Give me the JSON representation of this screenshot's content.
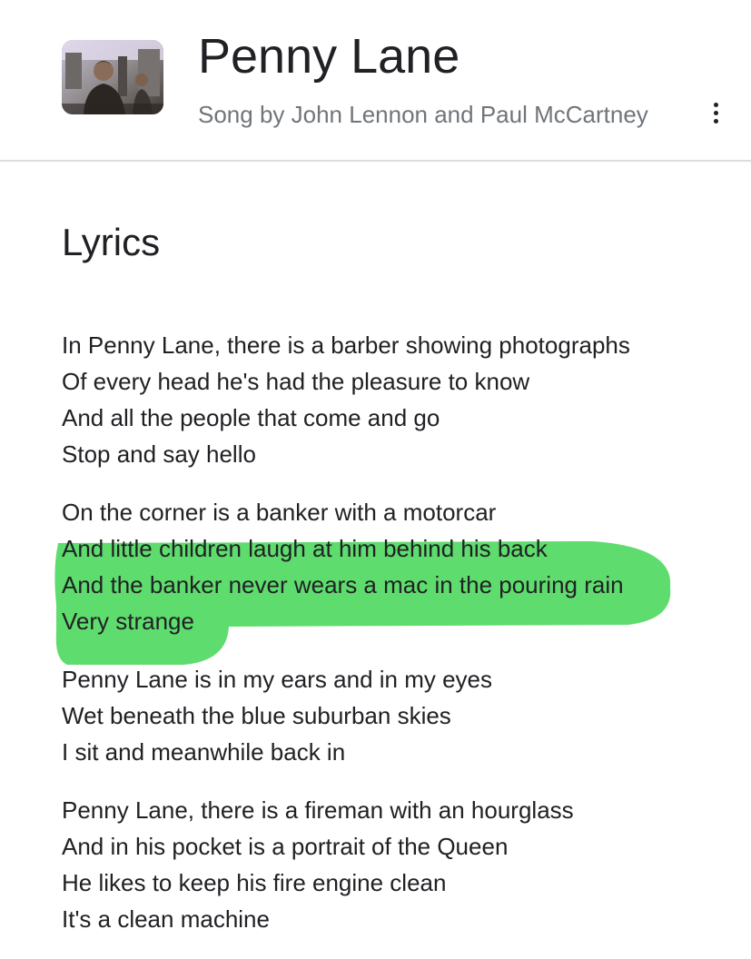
{
  "header": {
    "title": "Penny Lane",
    "subtitle": "Song by John Lennon and Paul McCartney",
    "more_icon": "more-vert-icon"
  },
  "lyrics": {
    "heading": "Lyrics",
    "stanzas": [
      {
        "lines": [
          "In Penny Lane, there is a barber showing photographs",
          "Of every head he's had the pleasure to know",
          "And all the people that come and go",
          "Stop and say hello"
        ]
      },
      {
        "lines": [
          "On the corner is a banker with a motorcar",
          "And little children laugh at him behind his back",
          "And the banker never wears a mac in the pouring rain",
          "Very strange"
        ]
      },
      {
        "lines": [
          "Penny Lane is in my ears and in my eyes",
          "Wet beneath the blue suburban skies",
          "I sit and meanwhile back in"
        ]
      },
      {
        "lines": [
          "Penny Lane, there is a fireman with an hourglass",
          "And in his pocket is a portrait of the Queen",
          "He likes to keep his fire engine clean",
          "It's a clean machine"
        ]
      }
    ]
  },
  "colors": {
    "highlight": "#5fdc6e",
    "title_text": "#202124",
    "subtitle_text": "#70757a",
    "divider": "#dadce0"
  }
}
